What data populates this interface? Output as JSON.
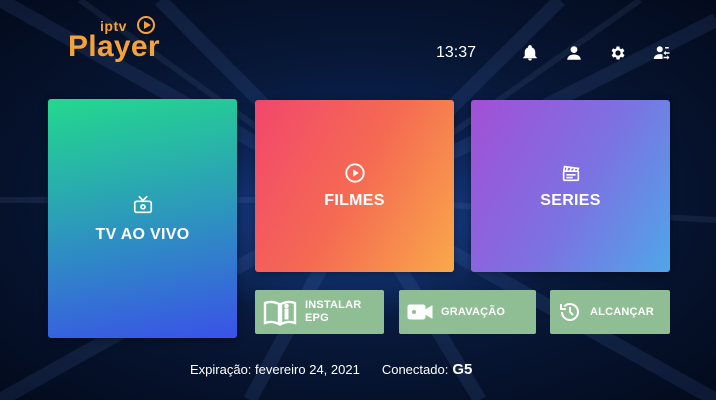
{
  "logo": {
    "small_text": "iptv",
    "main_text": "Player"
  },
  "topbar": {
    "time": "13:37",
    "icons": [
      "bell-icon",
      "user-icon",
      "gear-icon",
      "switch-user-icon"
    ]
  },
  "tiles": {
    "tv_label": "TV AO VIVO",
    "filmes_label": "FILMES",
    "series_label": "SERIES"
  },
  "actions": {
    "epg_line1": "INSTALAR",
    "epg_line2": "EPG",
    "gravacao": "GRAVAÇÃO",
    "alcancar": "ALCANÇAR"
  },
  "footer": {
    "expiracao": "Expiração: fevereiro 24, 2021",
    "conectado_label": "Conectado:",
    "conectado_value": "G5"
  },
  "colors": {
    "accent": "#f5a23a",
    "background": "#071634",
    "action_button": "#8fbe95"
  }
}
